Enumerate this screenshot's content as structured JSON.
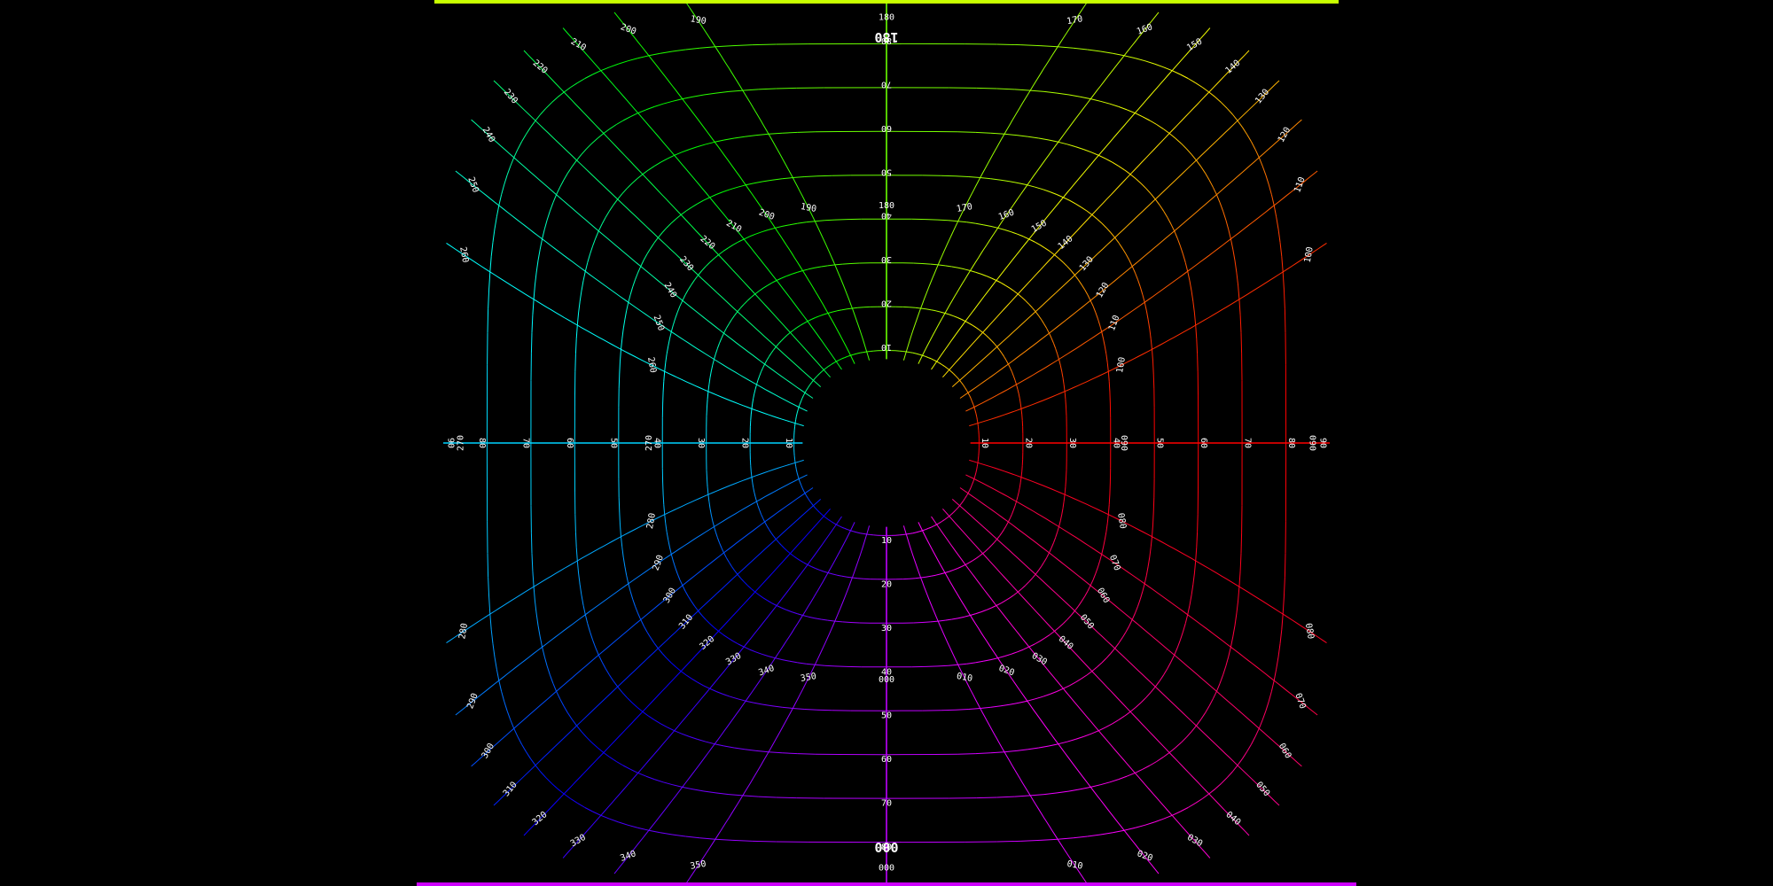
{
  "chart_data": {
    "type": "polar-grid-projection",
    "center_label": "",
    "ring_labels_inner": [
      "10",
      "20",
      "30",
      "40",
      "50",
      "60",
      "70",
      "80"
    ],
    "ring_labels_outer_x": [
      "90"
    ],
    "azimuth_labels": [
      "000",
      "010",
      "020",
      "030",
      "040",
      "050",
      "060",
      "070",
      "080",
      "090",
      "100",
      "110",
      "120",
      "130",
      "140",
      "150",
      "160",
      "170",
      "180",
      "190",
      "200",
      "210",
      "220",
      "230",
      "240",
      "250",
      "260",
      "270",
      "280",
      "290",
      "300",
      "310",
      "320",
      "330",
      "340",
      "350"
    ],
    "azimuth_step_deg": 10,
    "elevation_step_deg": 10,
    "edge_labels": {
      "top": "180",
      "bottom": "000"
    },
    "colors": {
      "background": "#000000",
      "hue_at_090": "#ff0000",
      "hue_at_180": "#c8ff00",
      "hue_at_270": "#00ffff",
      "hue_at_000": "#cc00ff",
      "labels": "#ffffff"
    }
  }
}
